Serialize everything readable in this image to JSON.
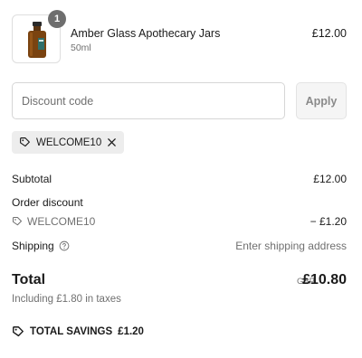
{
  "line_item": {
    "name": "Amber Glass Apothecary Jars",
    "variant": "50ml",
    "price": "£12.00",
    "quantity": "1"
  },
  "discount": {
    "placeholder": "Discount code",
    "apply_label": "Apply",
    "applied_code": "WELCOME10"
  },
  "summary": {
    "subtotal_label": "Subtotal",
    "subtotal_value": "£12.00",
    "order_discount_label": "Order discount",
    "discount_code": "WELCOME10",
    "discount_value": "− £1.20",
    "shipping_label": "Shipping",
    "shipping_value": "Enter shipping address"
  },
  "total": {
    "label": "Total",
    "currency": "GBP",
    "value": "£10.80",
    "taxes_note": "Including £1.80 in taxes"
  },
  "savings": {
    "label": "TOTAL SAVINGS",
    "value": "£1.20"
  },
  "colors": {
    "badge": "#6e6e6e",
    "chip_bg": "#ededed",
    "muted_text": "#707070"
  }
}
